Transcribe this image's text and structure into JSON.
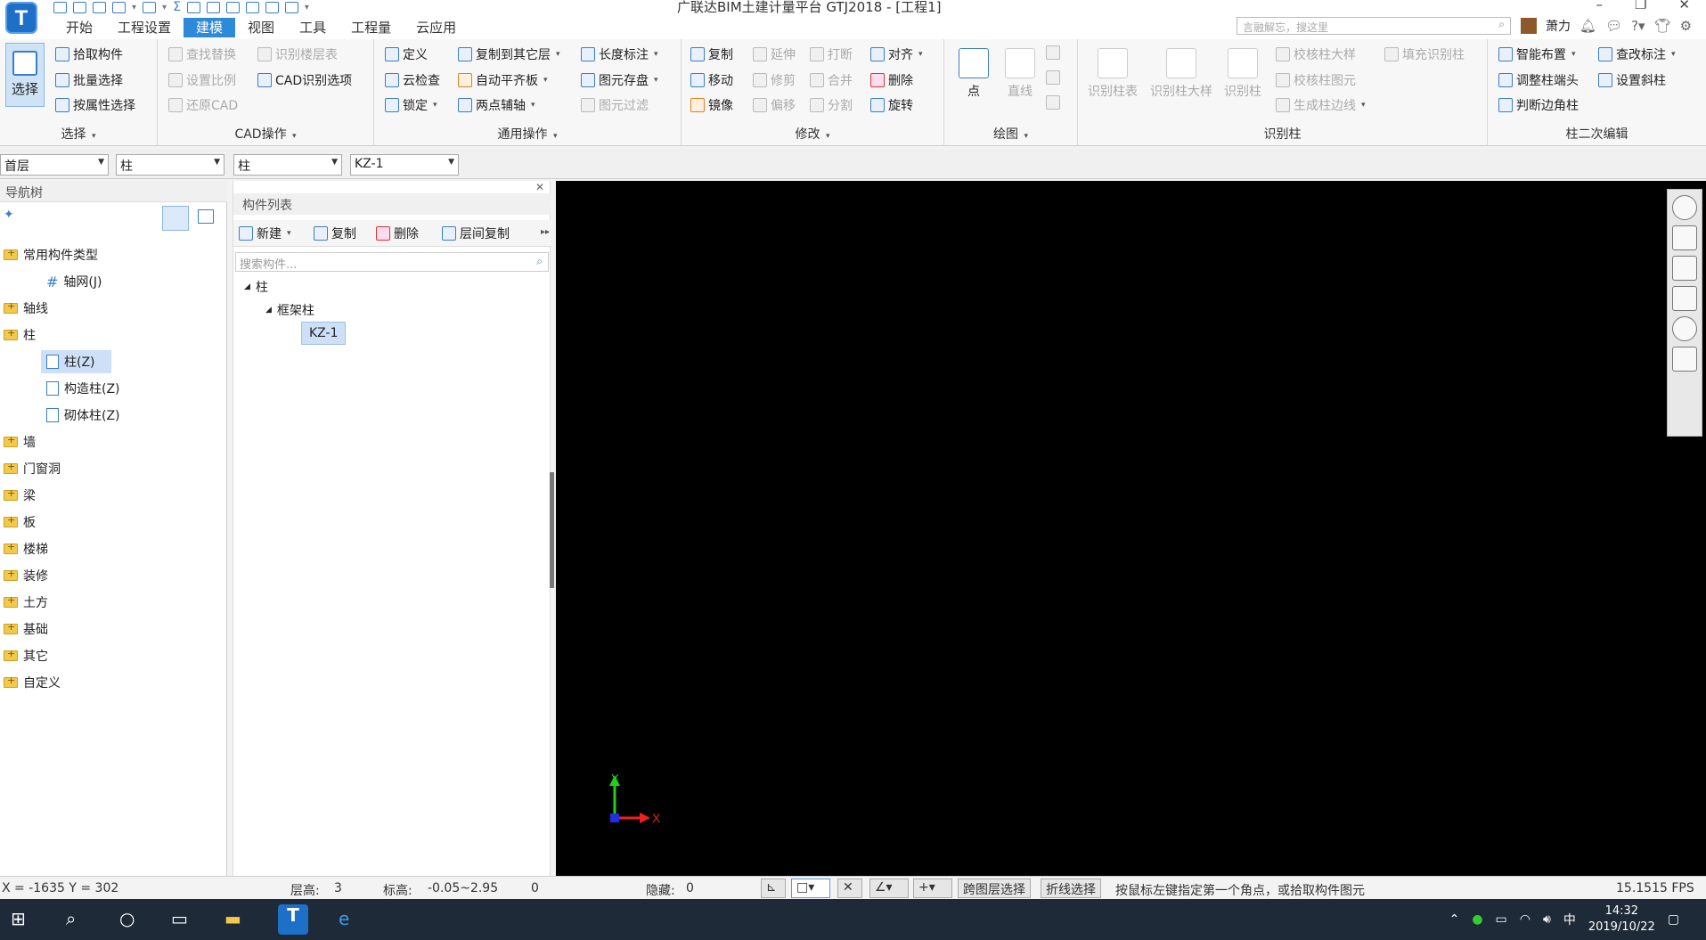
{
  "window": {
    "title": "广联达BIM土建计量平台 GTJ2018 - [工程1]",
    "minimize": "–",
    "restore": "❐",
    "close": "✕"
  },
  "logo": {
    "letter": "T"
  },
  "tabs": [
    "开始",
    "工程设置",
    "建模",
    "视图",
    "工具",
    "工程量",
    "云应用"
  ],
  "active_tab": "建模",
  "search": {
    "placeholder": "言融解忘，搜这里"
  },
  "user": {
    "name": "萧力"
  },
  "ribbon": {
    "select": {
      "big": "选择",
      "pick": "拾取构件",
      "batch": "批量选择",
      "byprop": "按属性选择",
      "group": "选择"
    },
    "cad": {
      "find": "查找替换",
      "floors": "识别楼层表",
      "scale": "设置比例",
      "options": "CAD识别选项",
      "restore": "还原CAD",
      "group": "CAD操作"
    },
    "general": {
      "define": "定义",
      "copyto": "复制到其它层",
      "length": "长度标注",
      "cloud": "云检查",
      "autoslab": "自动平齐板",
      "store": "图元存盘",
      "lock": "锁定",
      "twopoint": "两点辅轴",
      "filter": "图元过滤",
      "group": "通用操作"
    },
    "modify": {
      "copy": "复制",
      "extend": "延伸",
      "break": "打断",
      "align": "对齐",
      "move": "移动",
      "trim": "修剪",
      "merge": "合并",
      "delete": "删除",
      "mirror": "镜像",
      "offset": "偏移",
      "split": "分割",
      "rotate": "旋转",
      "group": "修改"
    },
    "draw": {
      "point": "点",
      "line": "直线",
      "group": "绘图"
    },
    "recognize": {
      "coltable": "识别柱表",
      "detail": "识别柱大样",
      "col": "识别柱",
      "checkdetail": "校核柱大样",
      "fill": "填充识别柱",
      "checkcol": "校核柱图元",
      "genedge": "生成柱边线",
      "group": "识别柱"
    },
    "edit2": {
      "smart": "智能布置",
      "check": "查改标注",
      "endcap": "调整柱端头",
      "slope": "设置斜柱",
      "corner": "判断边角柱",
      "group": "柱二次编辑"
    }
  },
  "combos": {
    "floor": "首层",
    "type1": "柱",
    "type2": "柱",
    "comp": "KZ-1"
  },
  "nav": {
    "title": "导航树",
    "items": [
      {
        "label": "常用构件类型",
        "level": 0
      },
      {
        "label": "轴网(J)",
        "level": 1
      },
      {
        "label": "轴线",
        "level": 0
      },
      {
        "label": "柱",
        "level": 0
      },
      {
        "label": "柱(Z)",
        "level": 1
      },
      {
        "label": "构造柱(Z)",
        "level": 1
      },
      {
        "label": "砌体柱(Z)",
        "level": 1
      },
      {
        "label": "墙",
        "level": 0
      },
      {
        "label": "门窗洞",
        "level": 0
      },
      {
        "label": "梁",
        "level": 0
      },
      {
        "label": "板",
        "level": 0
      },
      {
        "label": "楼梯",
        "level": 0
      },
      {
        "label": "装修",
        "level": 0
      },
      {
        "label": "土方",
        "level": 0
      },
      {
        "label": "基础",
        "level": 0
      },
      {
        "label": "其它",
        "level": 0
      },
      {
        "label": "自定义",
        "level": 0
      }
    ]
  },
  "comp": {
    "title": "构件列表",
    "new": "新建",
    "copy": "复制",
    "delete": "删除",
    "layercopy": "层间复制",
    "search_placeholder": "搜索构件...",
    "tree_root": "柱",
    "tree_group": "框架柱",
    "tree_leaf": "KZ-1"
  },
  "axes": {
    "y": "Y",
    "x": "X"
  },
  "status": {
    "coords": "X = -1635 Y = 302",
    "floor_height": "层高:",
    "floor_height_val": "3",
    "elevation": "标高:",
    "elevation_val": "-0.05~2.95",
    "zero": "0",
    "hidden": "隐藏:",
    "hidden_val": "0",
    "cross_layer": "跨图层选择",
    "polyline": "折线选择",
    "hint": "按鼠标左键指定第一个角点，或拾取构件图元",
    "fps": "15.1515 FPS"
  },
  "taskbar": {
    "ime": "中",
    "time": "14:32",
    "date": "2019/10/22"
  }
}
